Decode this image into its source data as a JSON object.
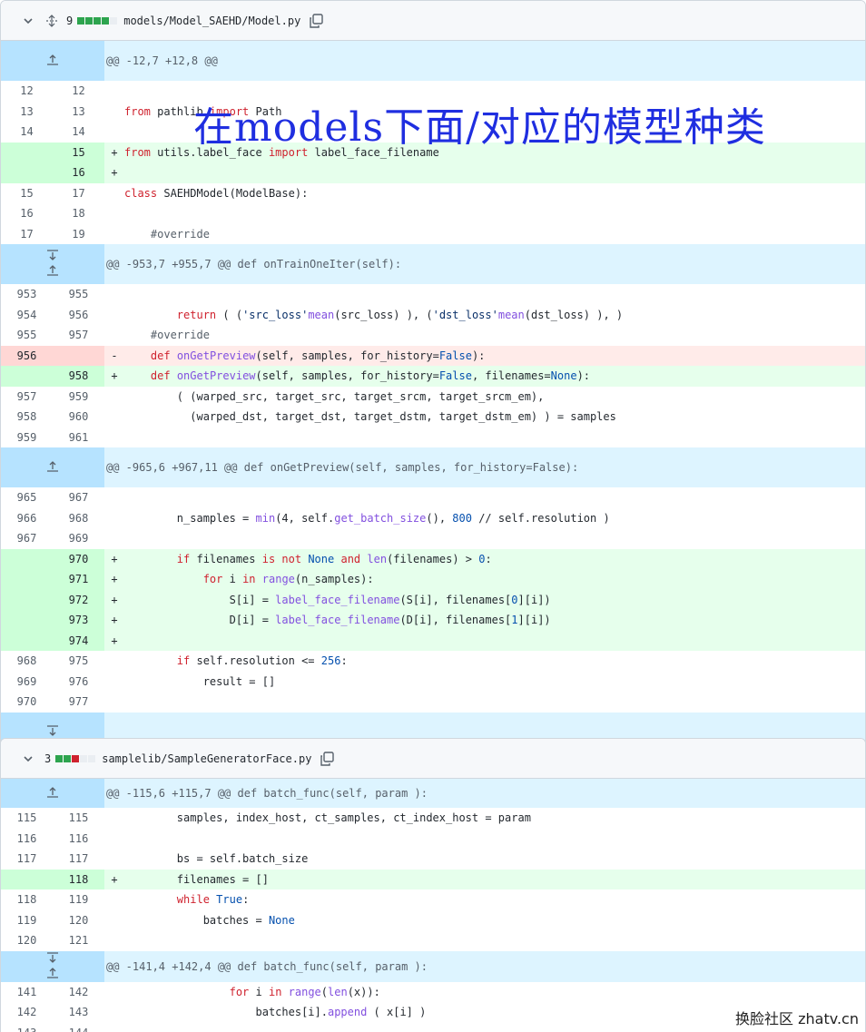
{
  "file1": {
    "changes": "9",
    "filename": "models/Model_SAEHD/Model.py",
    "diffstat_colors": [
      "#2da44e",
      "#2da44e",
      "#2da44e",
      "#2da44e",
      "#eaeef2"
    ],
    "rows": [
      {
        "t": "hunk",
        "text": "@@ -12,7 +12,8 @@",
        "arrows": "up"
      },
      {
        "t": "ctx",
        "l": "12",
        "r": "12",
        "code": []
      },
      {
        "t": "ctx",
        "l": "13",
        "r": "13",
        "code": [
          [
            "k",
            "from"
          ],
          [
            "",
            " pathlib "
          ],
          [
            "k",
            "import"
          ],
          [
            "",
            " Path"
          ]
        ]
      },
      {
        "t": "ctx",
        "l": "14",
        "r": "14",
        "code": []
      },
      {
        "t": "add",
        "l": "",
        "r": "15",
        "code": [
          [
            "k",
            "from"
          ],
          [
            "",
            " utils.label_face "
          ],
          [
            "k",
            "import"
          ],
          [
            "",
            " label_face_filename"
          ]
        ]
      },
      {
        "t": "add",
        "l": "",
        "r": "16",
        "code": []
      },
      {
        "t": "ctx",
        "l": "15",
        "r": "17",
        "code": [
          [
            "k",
            "class"
          ],
          [
            "",
            " SAEHDModel(ModelBase):"
          ]
        ]
      },
      {
        "t": "ctx",
        "l": "16",
        "r": "18",
        "code": []
      },
      {
        "t": "ctx",
        "l": "17",
        "r": "19",
        "code": [
          [
            "",
            "    "
          ],
          [
            "c",
            "#override"
          ]
        ]
      },
      {
        "t": "hunk",
        "text": "@@ -953,7 +955,7 @@ def onTrainOneIter(self):",
        "arrows": "both"
      },
      {
        "t": "ctx",
        "l": "953",
        "r": "955",
        "code": []
      },
      {
        "t": "ctx",
        "l": "954",
        "r": "956",
        "code": [
          [
            "",
            "        "
          ],
          [
            "k",
            "return"
          ],
          [
            "",
            " ( ("
          ],
          [
            "s",
            "'src_loss'"
          ],
          [
            ", np."
          ],
          [
            "f",
            "mean"
          ],
          [
            "",
            "(src_loss) ), ("
          ],
          [
            "s",
            "'dst_loss'"
          ],
          [
            ", np."
          ],
          [
            "f",
            "mean"
          ],
          [
            "",
            "(dst_loss) ), )"
          ]
        ]
      },
      {
        "t": "ctx",
        "l": "955",
        "r": "957",
        "code": [
          [
            "",
            "    "
          ],
          [
            "c",
            "#override"
          ]
        ]
      },
      {
        "t": "del",
        "l": "956",
        "r": "",
        "code": [
          [
            "",
            "    "
          ],
          [
            "k",
            "def"
          ],
          [
            "",
            " "
          ],
          [
            "f",
            "onGetPreview"
          ],
          [
            "",
            "(self, samples, for_history="
          ],
          [
            "n",
            "False"
          ],
          [
            "",
            "):"
          ]
        ]
      },
      {
        "t": "add",
        "l": "",
        "r": "958",
        "code": [
          [
            "",
            "    "
          ],
          [
            "k",
            "def"
          ],
          [
            "",
            " "
          ],
          [
            "f",
            "onGetPreview"
          ],
          [
            "",
            "(self, samples, for_history="
          ],
          [
            "n",
            "False"
          ],
          [
            "",
            ", filenames="
          ],
          [
            "n",
            "None"
          ],
          [
            "",
            "):"
          ]
        ]
      },
      {
        "t": "ctx",
        "l": "957",
        "r": "959",
        "code": [
          [
            "",
            "        ( (warped_src, target_src, target_srcm, target_srcm_em),"
          ]
        ]
      },
      {
        "t": "ctx",
        "l": "958",
        "r": "960",
        "code": [
          [
            "",
            "          (warped_dst, target_dst, target_dstm, target_dstm_em) ) = samples"
          ]
        ]
      },
      {
        "t": "ctx",
        "l": "959",
        "r": "961",
        "code": []
      },
      {
        "t": "hunk",
        "text": "@@ -965,6 +967,11 @@ def onGetPreview(self, samples, for_history=False):",
        "arrows": "up"
      },
      {
        "t": "ctx",
        "l": "965",
        "r": "967",
        "code": []
      },
      {
        "t": "ctx",
        "l": "966",
        "r": "968",
        "code": [
          [
            "",
            "        n_samples = "
          ],
          [
            "f",
            "min"
          ],
          [
            "",
            "(4, self."
          ],
          [
            "f",
            "get_batch_size"
          ],
          [
            "",
            "(), "
          ],
          [
            "n",
            "800"
          ],
          [
            "",
            " // self.resolution )"
          ]
        ]
      },
      {
        "t": "ctx",
        "l": "967",
        "r": "969",
        "code": []
      },
      {
        "t": "add",
        "l": "",
        "r": "970",
        "code": [
          [
            "",
            "        "
          ],
          [
            "k",
            "if"
          ],
          [
            "",
            " filenames "
          ],
          [
            "k",
            "is not"
          ],
          [
            "",
            " "
          ],
          [
            "n",
            "None"
          ],
          [
            "",
            " "
          ],
          [
            "k",
            "and"
          ],
          [
            "",
            " "
          ],
          [
            "f",
            "len"
          ],
          [
            "",
            "(filenames) > "
          ],
          [
            "n",
            "0"
          ],
          [
            "",
            ":"
          ]
        ]
      },
      {
        "t": "add",
        "l": "",
        "r": "971",
        "code": [
          [
            "",
            "            "
          ],
          [
            "k",
            "for"
          ],
          [
            "",
            " i "
          ],
          [
            "k",
            "in"
          ],
          [
            "",
            " "
          ],
          [
            "f",
            "range"
          ],
          [
            "",
            "(n_samples):"
          ]
        ]
      },
      {
        "t": "add",
        "l": "",
        "r": "972",
        "code": [
          [
            "",
            "                S[i] = "
          ],
          [
            "f",
            "label_face_filename"
          ],
          [
            "",
            "(S[i], filenames["
          ],
          [
            "n",
            "0"
          ],
          [
            "",
            "][i])"
          ]
        ]
      },
      {
        "t": "add",
        "l": "",
        "r": "973",
        "code": [
          [
            "",
            "                D[i] = "
          ],
          [
            "f",
            "label_face_filename"
          ],
          [
            "",
            "(D[i], filenames["
          ],
          [
            "n",
            "1"
          ],
          [
            "",
            "][i])"
          ]
        ]
      },
      {
        "t": "add",
        "l": "",
        "r": "974",
        "code": []
      },
      {
        "t": "ctx",
        "l": "968",
        "r": "975",
        "code": [
          [
            "",
            "        "
          ],
          [
            "k",
            "if"
          ],
          [
            "",
            " self.resolution <= "
          ],
          [
            "n",
            "256"
          ],
          [
            "",
            ":"
          ]
        ]
      },
      {
        "t": "ctx",
        "l": "969",
        "r": "976",
        "code": [
          [
            "",
            "            result = []"
          ]
        ]
      },
      {
        "t": "ctx",
        "l": "970",
        "r": "977",
        "code": []
      },
      {
        "t": "hunk",
        "text": "",
        "arrows": "down"
      }
    ]
  },
  "file2": {
    "changes": "3",
    "filename": "samplelib/SampleGeneratorFace.py",
    "diffstat_colors": [
      "#2da44e",
      "#2da44e",
      "#cf222e",
      "#eaeef2",
      "#eaeef2"
    ],
    "rows": [
      {
        "t": "hunk",
        "text": "@@ -115,6 +115,7 @@ def batch_func(self, param ):",
        "arrows": "up",
        "short": true
      },
      {
        "t": "ctx",
        "l": "115",
        "r": "115",
        "code": [
          [
            "",
            "        samples, index_host, ct_samples, ct_index_host = param"
          ]
        ]
      },
      {
        "t": "ctx",
        "l": "116",
        "r": "116",
        "code": []
      },
      {
        "t": "ctx",
        "l": "117",
        "r": "117",
        "code": [
          [
            "",
            "        bs = self.batch_size"
          ]
        ]
      },
      {
        "t": "add",
        "l": "",
        "r": "118",
        "code": [
          [
            "",
            "        filenames = []"
          ]
        ]
      },
      {
        "t": "ctx",
        "l": "118",
        "r": "119",
        "code": [
          [
            "",
            "        "
          ],
          [
            "k",
            "while"
          ],
          [
            "",
            " "
          ],
          [
            "n",
            "True"
          ],
          [
            "",
            ":"
          ]
        ]
      },
      {
        "t": "ctx",
        "l": "119",
        "r": "120",
        "code": [
          [
            "",
            "            batches = "
          ],
          [
            "n",
            "None"
          ]
        ]
      },
      {
        "t": "ctx",
        "l": "120",
        "r": "121",
        "code": []
      },
      {
        "t": "hunk",
        "text": "@@ -141,4 +142,4 @@ def batch_func(self, param ):",
        "arrows": "both",
        "short": true
      },
      {
        "t": "ctx",
        "l": "141",
        "r": "142",
        "code": [
          [
            "",
            "                "
          ],
          [
            "k",
            "for"
          ],
          [
            "",
            " i "
          ],
          [
            "k",
            "in"
          ],
          [
            "",
            " "
          ],
          [
            "f",
            "range"
          ],
          [
            "",
            "("
          ],
          [
            "f",
            "len"
          ],
          [
            "",
            "(x)):"
          ]
        ]
      },
      {
        "t": "ctx",
        "l": "142",
        "r": "143",
        "code": [
          [
            "",
            "                    batches[i]."
          ],
          [
            "f",
            "append"
          ],
          [
            "",
            " ( x[i] )"
          ]
        ]
      },
      {
        "t": "ctx",
        "l": "143",
        "r": "144",
        "code": []
      }
    ]
  },
  "annotation": "在models下面/对应的模型种类",
  "watermark": "换脸社区 zhatv.cn"
}
